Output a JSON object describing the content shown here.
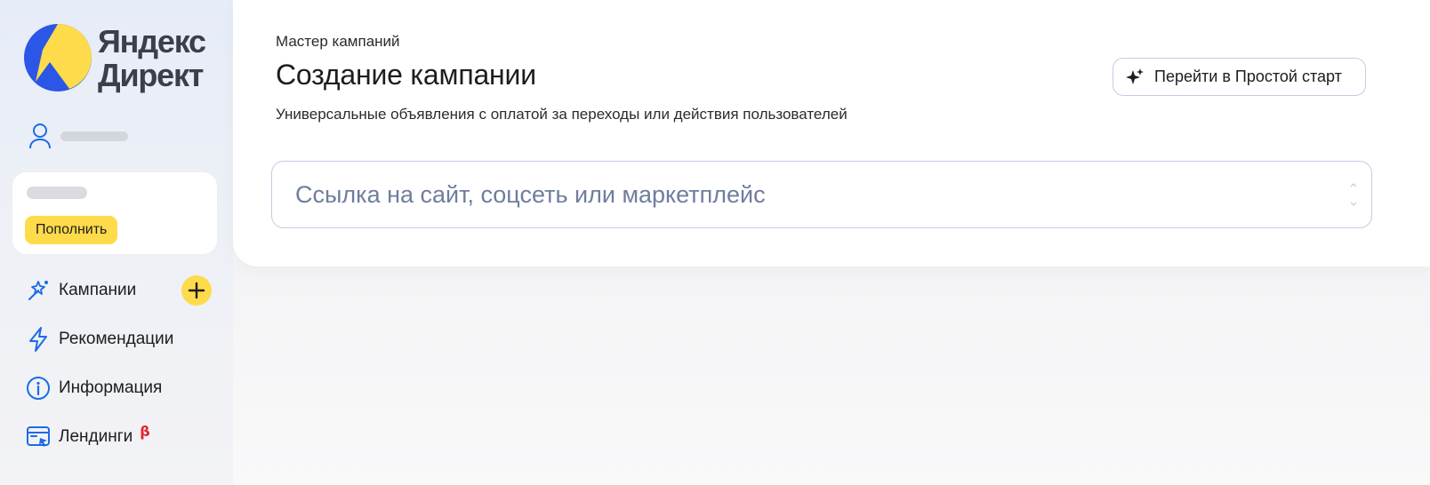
{
  "brand": {
    "line1": "Яндекс",
    "line2": "Директ",
    "colors": {
      "blue": "#2b56e6",
      "yellow": "#fedb4a",
      "text": "#3a3f4b"
    }
  },
  "user": {
    "icon": "user-icon"
  },
  "balance": {
    "topup_label": "Пополнить"
  },
  "nav": {
    "items": [
      {
        "label": "Кампании",
        "icon": "magic-wand-icon"
      },
      {
        "label": "Рекомендации",
        "icon": "lightning-icon"
      },
      {
        "label": "Информация",
        "icon": "info-icon"
      },
      {
        "label": "Лендинги",
        "icon": "landing-page-icon",
        "badge": "β"
      }
    ],
    "add_icon": "plus-icon"
  },
  "main": {
    "breadcrumb": "Мастер кампаний",
    "title": "Создание кампании",
    "subtitle": "Универсальные объявления с оплатой за переходы или действия пользователей",
    "simple_start_label": "Перейти в Простой старт",
    "simple_start_icon": "sparkles-icon",
    "url_input": {
      "value": "",
      "placeholder": "Ссылка на сайт, соцсеть или маркетплейс"
    }
  },
  "colors": {
    "accent_yellow": "#fedb4a",
    "icon_blue": "#1a6ce8",
    "beta_red": "#e8202a",
    "border": "#c4cbe1",
    "placeholder": "#6f7d9e"
  }
}
